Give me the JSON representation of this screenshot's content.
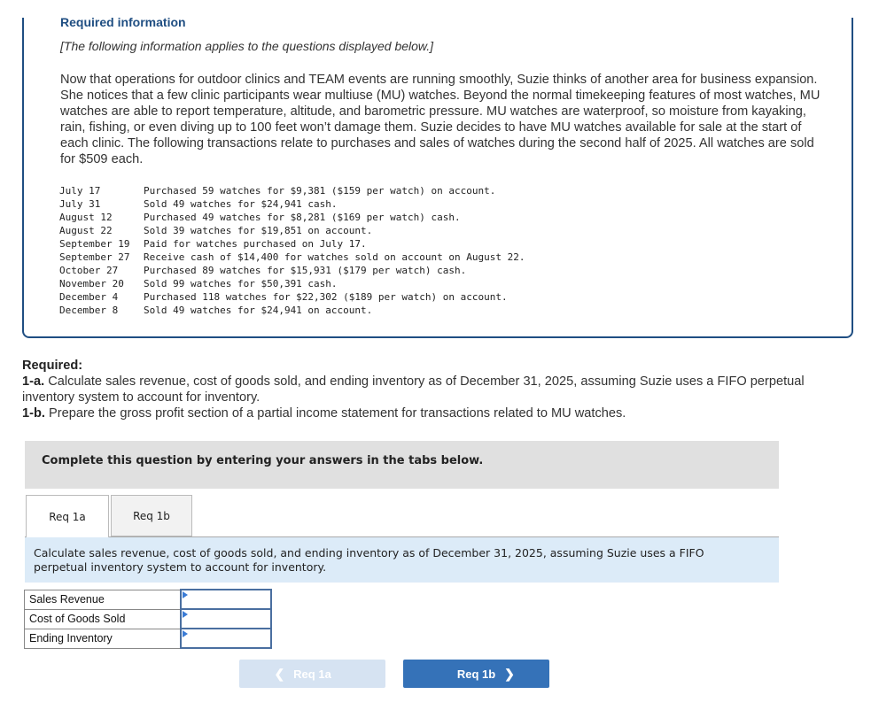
{
  "info": {
    "title": "Required information",
    "note": "[The following information applies to the questions displayed below.]",
    "paragraph": "Now that operations for outdoor clinics and TEAM events are running smoothly, Suzie thinks of another area for business expansion. She notices that a few clinic participants wear multiuse (MU) watches. Beyond the normal timekeeping features of most watches, MU watches are able to report temperature, altitude, and barometric pressure. MU watches are waterproof, so moisture from kayaking, rain, fishing, or even diving up to 100 feet won’t damage them. Suzie decides to have MU watches available for sale at the start of each clinic. The following transactions relate to purchases and sales of watches during the second half of 2025. All watches are sold for $509 each.",
    "transactions": [
      {
        "date": "July 17",
        "text": "Purchased 59 watches for $9,381 ($159 per watch) on account."
      },
      {
        "date": "July 31",
        "text": "Sold 49 watches for $24,941 cash."
      },
      {
        "date": "August 12",
        "text": "Purchased 49 watches for $8,281 ($169 per watch) cash."
      },
      {
        "date": "August 22",
        "text": "Sold 39 watches for $19,851 on account."
      },
      {
        "date": "September 19",
        "text": "Paid for watches purchased on July 17."
      },
      {
        "date": "September 27",
        "text": "Receive cash of $14,400 for watches sold on account on August 22."
      },
      {
        "date": "October 27",
        "text": "Purchased 89 watches for $15,931 ($179 per watch) cash."
      },
      {
        "date": "November 20",
        "text": "Sold 99 watches for $50,391 cash."
      },
      {
        "date": "December 4",
        "text": "Purchased 118 watches for $22,302 ($189 per watch) on account."
      },
      {
        "date": "December 8",
        "text": "Sold 49 watches for $24,941 on account."
      }
    ]
  },
  "required": {
    "heading": "Required:",
    "items": [
      {
        "label": "1-a.",
        "text": " Calculate sales revenue, cost of goods sold, and ending inventory as of December 31, 2025, assuming Suzie uses a FIFO perpetual inventory system to account for inventory."
      },
      {
        "label": "1-b.",
        "text": " Prepare the gross profit section of a partial income statement for transactions related to MU watches."
      }
    ]
  },
  "banner": "Complete this question by entering your answers in the tabs below.",
  "tabs": [
    {
      "label": "Req 1a",
      "active": true
    },
    {
      "label": "Req 1b",
      "active": false
    }
  ],
  "tab_description": "Calculate sales revenue, cost of goods sold, and ending inventory as of December 31, 2025, assuming Suzie uses a FIFO perpetual inventory system to account for inventory.",
  "answer_rows": [
    {
      "label": "Sales Revenue",
      "value": ""
    },
    {
      "label": "Cost of Goods Sold",
      "value": ""
    },
    {
      "label": "Ending Inventory",
      "value": ""
    }
  ],
  "nav": {
    "prev_label": "Req 1a",
    "next_label": "Req 1b",
    "prev_icon": "chevron-left-icon",
    "next_icon": "chevron-right-icon"
  }
}
